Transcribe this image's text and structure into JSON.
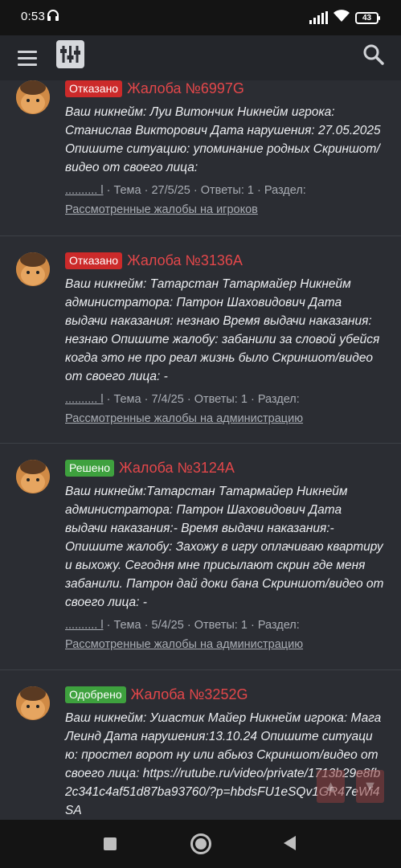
{
  "status_bar": {
    "time": "0:53",
    "battery": "43"
  },
  "app_bar": {
    "menu_icon": "hamburger-menu-icon",
    "filter_icon": "filter-sliders-icon",
    "search_icon": "search-icon"
  },
  "threads": [
    {
      "status": "Отказано",
      "status_color": "#cc2a2a",
      "title": "Жалоба №6997G",
      "snippet": "Ваш никнейм: Луи Витончик Никнейм игрока: Станислав Викторович Дата нарушения: 27.05.2025 Опишите ситуацию: упоминание родных Скриншот/видео от своего лица:",
      "author": ".......... l",
      "type": "Тема",
      "date": "27/5/25",
      "replies": "Ответы: 1",
      "section_label": "Раздел:",
      "section": "Рассмотренные жалобы на игроков"
    },
    {
      "status": "Отказано",
      "status_color": "#cc2a2a",
      "title": "Жалоба №3136A",
      "snippet": "Ваш никнейм: Татарстан Татармайер Никнейм администратора: Патрон Шаховидович Дата выдачи наказания: незнаю Время выдачи наказания: незнаю Опишите жалобу: забанили за словой убейся когда это не про реал жизнь было Скриншот/видео от своего лица: -",
      "author": ".......... l",
      "type": "Тема",
      "date": "7/4/25",
      "replies": "Ответы: 1",
      "section_label": "Раздел:",
      "section": "Рассмотренные жалобы на администрацию"
    },
    {
      "status": "Решено",
      "status_color": "#3ea13e",
      "title": "Жалоба №3124A",
      "snippet": "Ваш никнейм:Татарстан Татармайер Никнейм администратора: Патрон Шаховидович Дата выдачи наказания:- Время выдачи наказания:- Опишите жалобу: Захожу в игру оплачиваю квартиру и выхожу. Сегодня мне присылают скрин где меня забанили. Патрон дай доки бана Скриншот/видео от своего лица: -",
      "author": ".......... l",
      "type": "Тема",
      "date": "5/4/25",
      "replies": "Ответы: 1",
      "section_label": "Раздел:",
      "section": "Рассмотренные жалобы на администрацию"
    },
    {
      "status": "Одобрено",
      "status_color": "#3ea13e",
      "title": "Жалоба №3252G",
      "snippet": "Ваш никнейм: Ушастик Майер Никнейм игрока: Мага Леинд Дата нарушения:13.10.24 Опишите ситуацию: простел ворот ну или абьюз Скриншот/видео от своего лица: https://rutube.ru/video/private/1713b29e8fb2c341c4af51d87ba93760/?p=hbdsFU1eSQv1GR47eWi4SA"
    }
  ],
  "scroll_buttons": {
    "up_icon": "arrow-up-icon",
    "down_icon": "arrow-down-icon"
  },
  "nav_bar": {
    "recents_icon": "recents-square-icon",
    "home_icon": "home-circle-icon",
    "back_icon": "back-triangle-icon"
  }
}
